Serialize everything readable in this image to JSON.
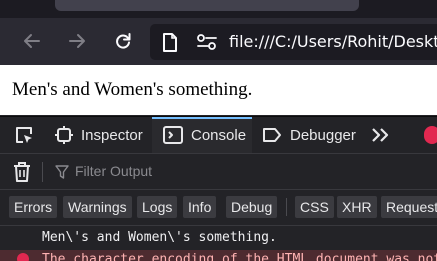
{
  "browser": {
    "url": "file:///C:/Users/Rohit/Desktop/"
  },
  "page": {
    "text": "Men's and Women's something."
  },
  "devtools": {
    "tabs": [
      "Inspector",
      "Console",
      "Debugger"
    ],
    "filter_placeholder": "Filter Output",
    "chips": [
      "Errors",
      "Warnings",
      "Logs",
      "Info",
      "Debug",
      "CSS",
      "XHR",
      "Requests"
    ],
    "log_output": "Men\\'s and Women\\'s something.",
    "error_output": "The character encoding of the HTML document was not declared."
  },
  "colors": {
    "accent": "#75bfff",
    "error": "#e22850"
  }
}
